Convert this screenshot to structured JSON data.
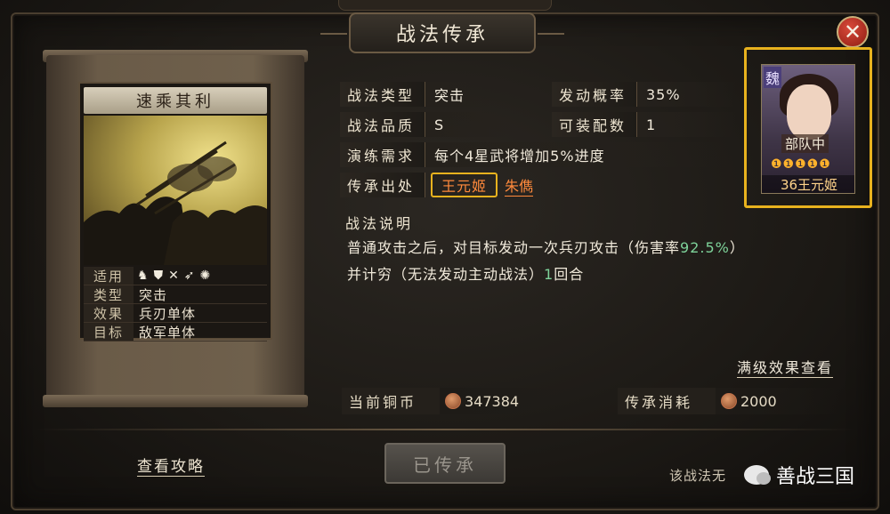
{
  "dialog": {
    "title": "战法传承",
    "close_icon": "close-icon"
  },
  "skill_card": {
    "name": "速乘其利",
    "rows": [
      {
        "key": "适用",
        "value": ""
      },
      {
        "key": "类型",
        "value": "突击"
      },
      {
        "key": "效果",
        "value": "兵刃单体"
      },
      {
        "key": "目标",
        "value": "敌军单体"
      }
    ],
    "unit_icons": [
      "cavalry-icon",
      "shield-icon",
      "bow-icon",
      "spear-icon",
      "siege-icon"
    ]
  },
  "info": {
    "type_label": "战法类型",
    "type_value": "突击",
    "trigger_label": "发动概率",
    "trigger_value": "35%",
    "quality_label": "战法品质",
    "quality_value": "S",
    "equip_label": "可装配数",
    "equip_value": "1",
    "practice_label": "演练需求",
    "practice_value": "每个4星武将增加5%进度",
    "source_label": "传承出处",
    "source_primary": "王元姬",
    "source_secondary": "朱儁"
  },
  "description": {
    "label": "战法说明",
    "line1_prefix": "普通攻击之后，对目标发动一次兵刃攻击（伤害率",
    "line1_rate": "92.5%",
    "line1_suffix": "）",
    "line2_prefix": "并计穷（无法发动主动战法）",
    "line2_turns": "1",
    "line2_suffix": "回合"
  },
  "general": {
    "kingdom": "魏",
    "troop": "部队中",
    "stars": "❶❶❶❶❶",
    "level": "36",
    "name": "王元姬",
    "level_name": "36王元姬"
  },
  "full_effect_link": "满级效果查看",
  "costs": {
    "coins_label": "当前铜币",
    "coins_value": "347384",
    "inherit_cost_label": "传承消耗",
    "inherit_cost_value": "2000"
  },
  "footer": {
    "guide_link": "查看攻略",
    "inherit_button": "已传承",
    "note": "该战法无",
    "watermark": "善战三国"
  },
  "colors": {
    "highlight_border": "#e8b21e",
    "link_orange": "#ff8a3c",
    "rate_green": "#7ed39a"
  }
}
